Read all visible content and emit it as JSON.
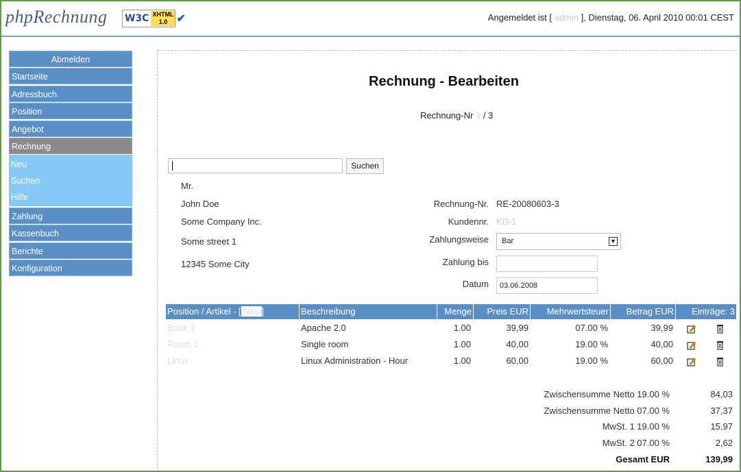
{
  "header": {
    "logo_text": "phpRechnung",
    "badge": {
      "w3c": "W3C",
      "xhtml": "XHTML",
      "version": "1.0"
    },
    "login_prefix": "Angemeldet ist [",
    "login_user": "admin",
    "login_suffix": "],",
    "datetime": "Dienstag, 06. April 2010 00:01 CEST"
  },
  "sidebar": {
    "logout": "Abmelden",
    "items_top": [
      "Startseite",
      "Adressbuch",
      "Position",
      "Angebot"
    ],
    "active": "Rechnung",
    "sub_items": [
      "Neu",
      "Suchen",
      "Hilfe"
    ],
    "items_bottom": [
      "Zahlung",
      "Kassenbuch",
      "Berichte",
      "Konfiguration"
    ]
  },
  "main": {
    "title": "Rechnung - Bearbeiten",
    "rnr_label": "Rechnung-Nr",
    "rnr_value_hidden": "3",
    "rnr_suffix": "/ 3",
    "search": {
      "value": "",
      "button": "Suchen"
    },
    "address": {
      "salutation": "Mr.",
      "name": "John Doe",
      "company": "Some Company Inc.",
      "street": "Some street 1",
      "city": "12345  Some City"
    },
    "fields": {
      "rechnung_nr_label": "Rechnung-Nr.",
      "rechnung_nr_value": "RE-20080603-3",
      "kunden_nr_label": "Kundennr.",
      "kunden_nr_value": "KD-1",
      "zahlungsweise_label": "Zahlungsweise",
      "zahlungsweise_value": "Bar",
      "zahlung_bis_label": "Zahlung bis",
      "zahlung_bis_value": "",
      "datum_label": "Datum",
      "datum_value": "03.06.2008"
    },
    "table": {
      "headers": {
        "position": "Position / Artikel - [",
        "position_new": "Neu",
        "position_close": "]",
        "beschreibung": "Beschreibung",
        "menge": "Menge",
        "preis": "Preis EUR",
        "mwst": "Mehrwertsteuer",
        "betrag": "Betrag EUR",
        "eintraege": "Einträge: 3"
      },
      "rows": [
        {
          "artikel": "Book 3",
          "beschreibung": "Apache 2.0",
          "menge": "1.00",
          "preis": "39,99",
          "mwst": "07.00 %",
          "betrag": "39,99"
        },
        {
          "artikel": "Room 1",
          "beschreibung": "Single room",
          "menge": "1.00",
          "preis": "40,00",
          "mwst": "19.00 %",
          "betrag": "40,00"
        },
        {
          "artikel": "Linux",
          "beschreibung": "Linux Administration - Hour",
          "menge": "1.00",
          "preis": "60,00",
          "mwst": "19.00 %",
          "betrag": "60,00"
        }
      ]
    },
    "totals": [
      {
        "label": "Zwischensumme Netto 19.00 %",
        "value": "84,03"
      },
      {
        "label": "Zwischensumme Netto 07.00 %",
        "value": "37,37"
      },
      {
        "label": "MwSt. 1 19.00 %",
        "value": "15,97"
      },
      {
        "label": "MwSt. 2 07.00 %",
        "value": "2,62"
      },
      {
        "label": "Gesamt EUR",
        "value": "139,99"
      }
    ]
  }
}
